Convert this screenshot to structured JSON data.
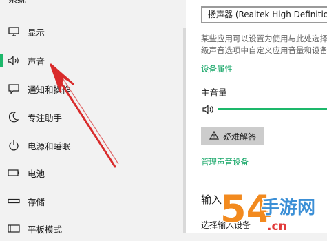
{
  "sidebar": {
    "title": "系统",
    "items": [
      {
        "label": "显示",
        "icon": "display-icon"
      },
      {
        "label": "声音",
        "icon": "speaker-icon",
        "selected": true
      },
      {
        "label": "通知和操作",
        "icon": "notification-icon"
      },
      {
        "label": "专注助手",
        "icon": "moon-icon"
      },
      {
        "label": "电源和睡眠",
        "icon": "power-icon"
      },
      {
        "label": "电池",
        "icon": "battery-icon"
      },
      {
        "label": "存储",
        "icon": "storage-icon"
      },
      {
        "label": "平板模式",
        "icon": "tablet-icon"
      }
    ]
  },
  "content": {
    "output_device": "扬声器 (Realtek High Definition Audio)",
    "description_line1": "某些应用可以设置为使用与此处选择",
    "description_line2": "级声音选项中自定义应用音量和设备",
    "device_properties_link": "设备属性",
    "master_volume_label": "主音量",
    "troubleshoot_label": "疑难解答",
    "manage_devices_link": "管理声音设备",
    "input_title": "输入",
    "input_select_label": "选择输入设备"
  },
  "watermark": {
    "brand": "54手游网",
    "domain": "手游网.cn"
  },
  "colors": {
    "accent": "#1db86b",
    "link": "#1aa86a",
    "arrow": "#d92b2b"
  }
}
